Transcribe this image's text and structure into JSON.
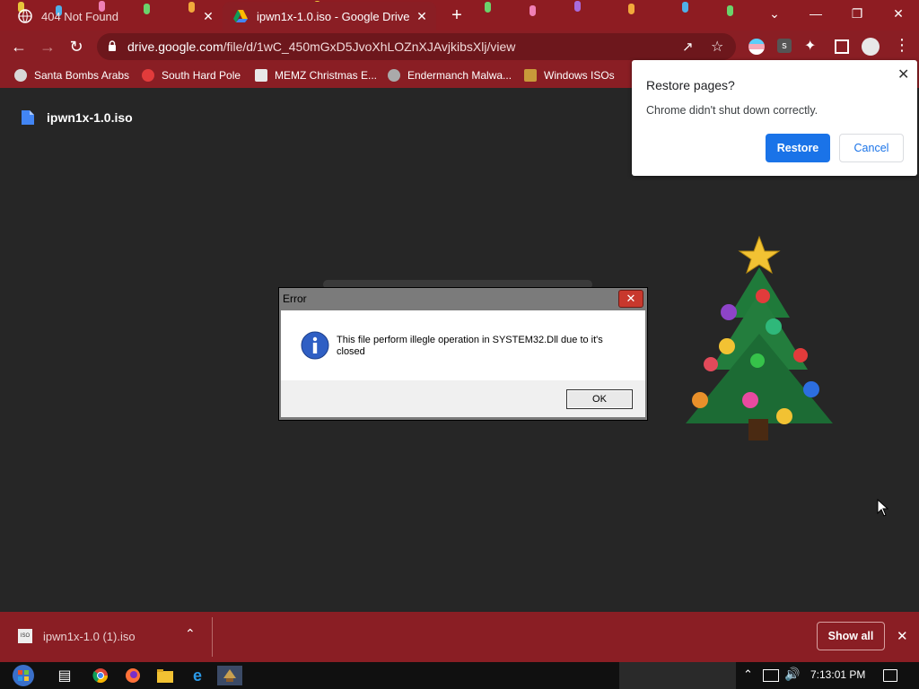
{
  "tabs": [
    {
      "title": "404 Not Found",
      "close": "✕"
    },
    {
      "title": "ipwn1x-1.0.iso - Google Drive",
      "close": "✕"
    }
  ],
  "new_tab": "+",
  "window_controls": {
    "minimize": "—",
    "maximize": "❐",
    "close": "✕",
    "tab_search": "⌄"
  },
  "omnibox": {
    "domain": "drive.google.com",
    "path": "/file/d/1wC_450mGxD5JvoXhLOZnXJAvjkibsXlj/view"
  },
  "bookmarks": [
    "Santa Bombs Arabs",
    "South Hard Pole",
    "MEMZ Christmas E...",
    "Endermanch Malwa...",
    "Windows ISOs"
  ],
  "file": {
    "name": "ipwn1x-1.0.iso"
  },
  "restore_popup": {
    "title": "Restore pages?",
    "message": "Chrome didn't shut down correctly.",
    "restore_label": "Restore",
    "cancel_label": "Cancel",
    "close": "✕"
  },
  "error_dialog": {
    "title": "Error",
    "message": "This file perform illegle operation in SYSTEM32.Dll due to it's closed",
    "ok_label": "OK",
    "close": "✕"
  },
  "download_bar": {
    "file_name": "ipwn1x-1.0 (1).iso",
    "show_all_label": "Show all",
    "close": "✕",
    "file_icon_text": "ISO"
  },
  "taskbar": {
    "clock": "7:13:01 PM"
  },
  "colors": {
    "chrome_theme": "#8a1e24",
    "content_bg": "#262626",
    "restore_blue": "#1a73e8"
  }
}
